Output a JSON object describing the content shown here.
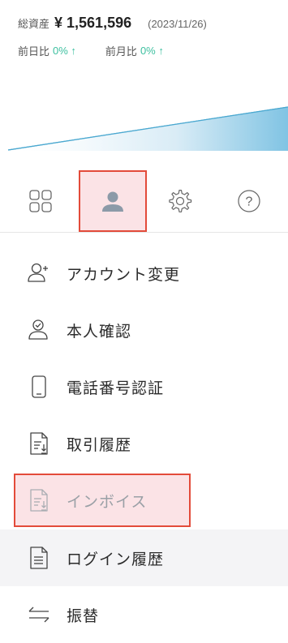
{
  "summary": {
    "asset_label": "総資産",
    "asset_value": "¥ 1,561,596",
    "date": "(2023/11/26)",
    "day_label": "前日比",
    "day_value": "0% ↑",
    "month_label": "前月比",
    "month_value": "0% ↑"
  },
  "colors": {
    "accent": "#3ec0a0",
    "highlight_border": "#e34b3a",
    "highlight_fill": "#fbe3e6",
    "chart_line": "#4aa8d0"
  },
  "tabs": [
    {
      "icon": "grid-icon"
    },
    {
      "icon": "user-icon",
      "selected": true
    },
    {
      "icon": "gear-icon"
    },
    {
      "icon": "help-icon"
    }
  ],
  "menu": [
    {
      "icon": "add-user-icon",
      "label": "アカウント変更"
    },
    {
      "icon": "verify-user-icon",
      "label": "本人確認"
    },
    {
      "icon": "phone-icon",
      "label": "電話番号認証"
    },
    {
      "icon": "document-download-icon",
      "label": "取引履歴"
    },
    {
      "icon": "document-download-icon",
      "label": "インボイス"
    },
    {
      "icon": "document-icon",
      "label": "ログイン履歴"
    },
    {
      "icon": "transfer-icon",
      "label": "振替"
    }
  ]
}
